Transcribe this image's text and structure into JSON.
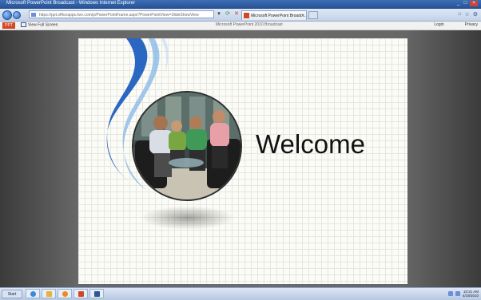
{
  "window": {
    "title": "Microsoft PowerPoint Broadcast - Windows Internet Explorer"
  },
  "browser": {
    "address": "https://ppt.officeapps.live.com/p/PowerPointFrame.aspx?PowerPointView=SlideShowView",
    "tab_label": "Microsoft PowerPoint Broadc...",
    "tab_close": "×"
  },
  "appbar": {
    "ppt_button": "PPT",
    "view_full_screen": "View Full Screen",
    "subtitle": "Microsoft PowerPoint 2010 Broadcast",
    "login": "Login",
    "privacy": "Privacy"
  },
  "slide": {
    "headline": "Welcome"
  },
  "taskbar": {
    "start_label": "Start",
    "clock_time": "10:21 AM",
    "clock_date": "4/19/2010"
  },
  "colors": {
    "accent_blue": "#1f5fbf",
    "ppt_orange": "#d24726"
  }
}
